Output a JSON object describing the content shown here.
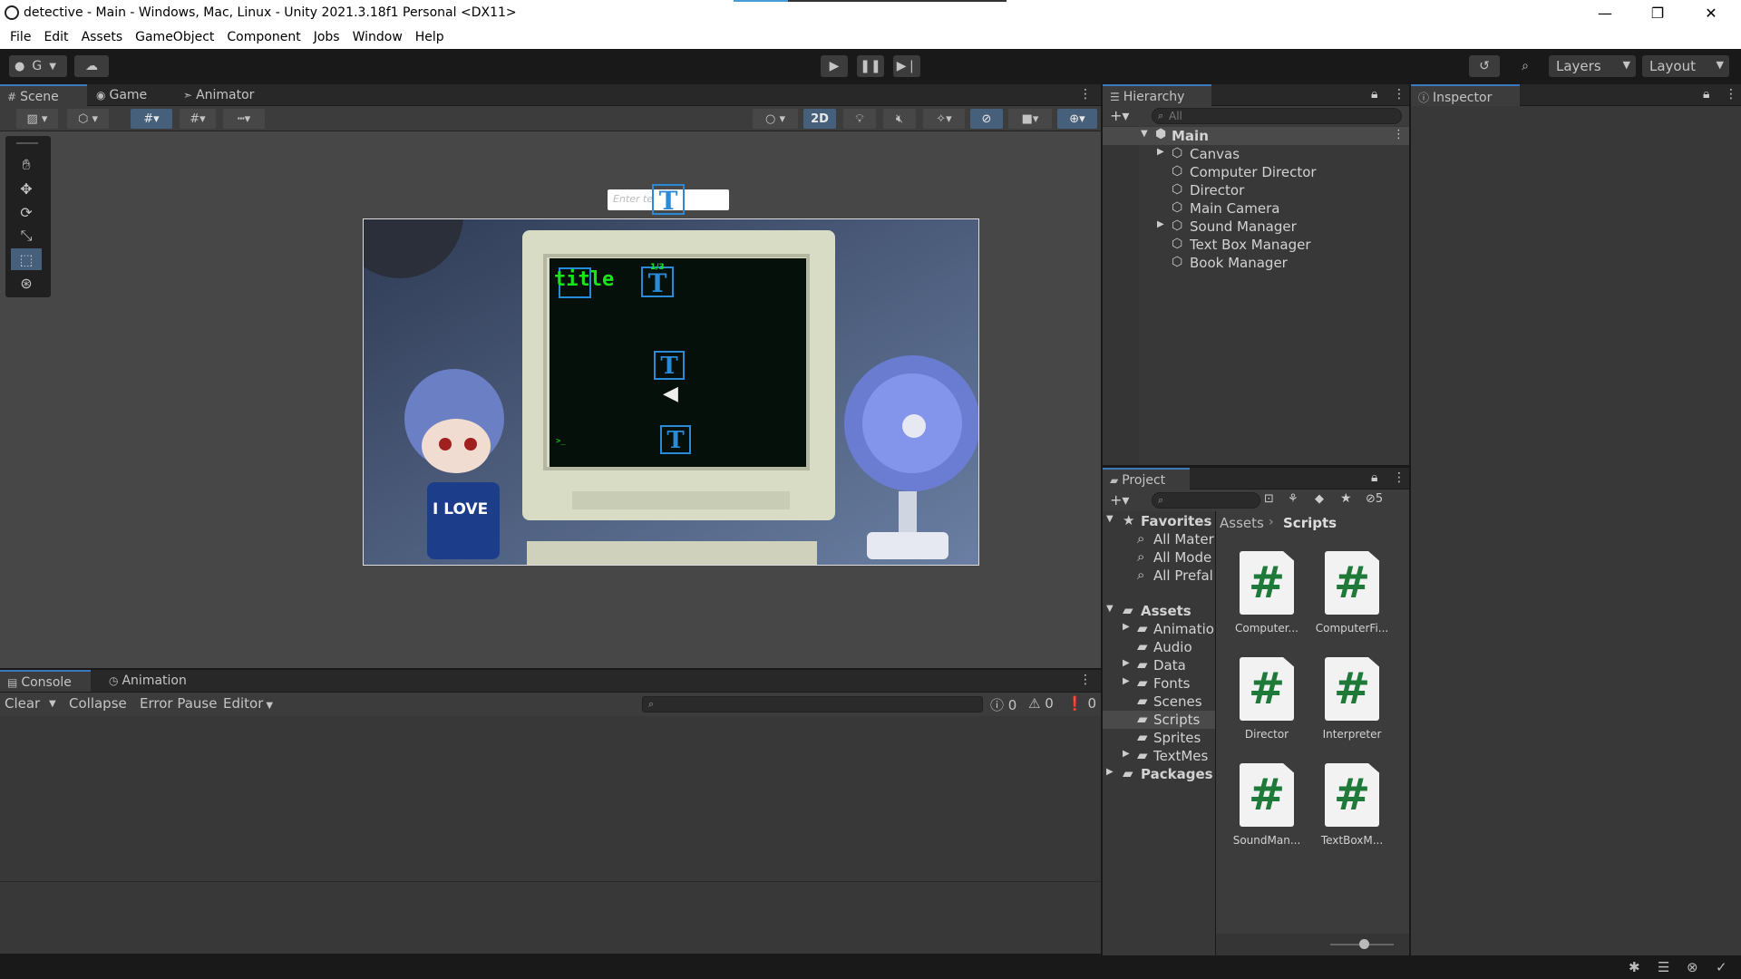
{
  "window": {
    "title": "detective - Main - Windows, Mac, Linux - Unity 2021.3.18f1 Personal <DX11>",
    "controls": [
      "—",
      "❐",
      "✕"
    ]
  },
  "menu": [
    "File",
    "Edit",
    "Assets",
    "GameObject",
    "Component",
    "Jobs",
    "Window",
    "Help"
  ],
  "toolbar": {
    "account": "G",
    "layers_label": "Layers",
    "layout_label": "Layout"
  },
  "scene_tabs": [
    "Scene",
    "Game",
    "Animator"
  ],
  "scene_toolbar": {
    "two_d_label": "2D"
  },
  "scene_overlay": {
    "input_placeholder": "Enter te",
    "title_text": "title",
    "counter_text": "1/3",
    "prompt_text": ">_",
    "mug_text": "I LOVE",
    "t_glyph": "T"
  },
  "console": {
    "tabs": [
      "Console",
      "Animation"
    ],
    "buttons": {
      "clear": "Clear",
      "collapse": "Collapse",
      "error_pause": "Error Pause",
      "editor": "Editor"
    },
    "counts": {
      "log": "0",
      "warn": "0",
      "error": "0"
    }
  },
  "hierarchy": {
    "tab": "Hierarchy",
    "search_placeholder": "All",
    "scene": "Main",
    "items": [
      {
        "label": "Canvas",
        "expandable": true
      },
      {
        "label": "Computer Director",
        "expandable": false
      },
      {
        "label": "Director",
        "expandable": false
      },
      {
        "label": "Main Camera",
        "expandable": false
      },
      {
        "label": "Sound Manager",
        "expandable": true
      },
      {
        "label": "Text Box Manager",
        "expandable": false
      },
      {
        "label": "Book Manager",
        "expandable": false
      }
    ]
  },
  "inspector": {
    "tab": "Inspector"
  },
  "project": {
    "tab": "Project",
    "hidden_count": "5",
    "favorites_label": "Favorites",
    "favorites": [
      "All Mater",
      "All Mode",
      "All Prefal"
    ],
    "assets_label": "Assets",
    "folders": [
      {
        "label": "Animatio",
        "expandable": true
      },
      {
        "label": "Audio",
        "expandable": false
      },
      {
        "label": "Data",
        "expandable": true
      },
      {
        "label": "Fonts",
        "expandable": true
      },
      {
        "label": "Scenes",
        "expandable": false
      },
      {
        "label": "Scripts",
        "expandable": false
      },
      {
        "label": "Sprites",
        "expandable": false
      },
      {
        "label": "TextMes",
        "expandable": true
      }
    ],
    "packages_label": "Packages",
    "breadcrumb": [
      "Assets",
      "Scripts"
    ],
    "files": [
      "Computer...",
      "ComputerFi...",
      "Director",
      "Interpreter",
      "SoundMan...",
      "TextBoxM..."
    ]
  },
  "colors": {
    "accent": "#3a79bb",
    "selection": "#46607c",
    "terminal_green": "#19e619",
    "script_green": "#1f7a3a"
  }
}
